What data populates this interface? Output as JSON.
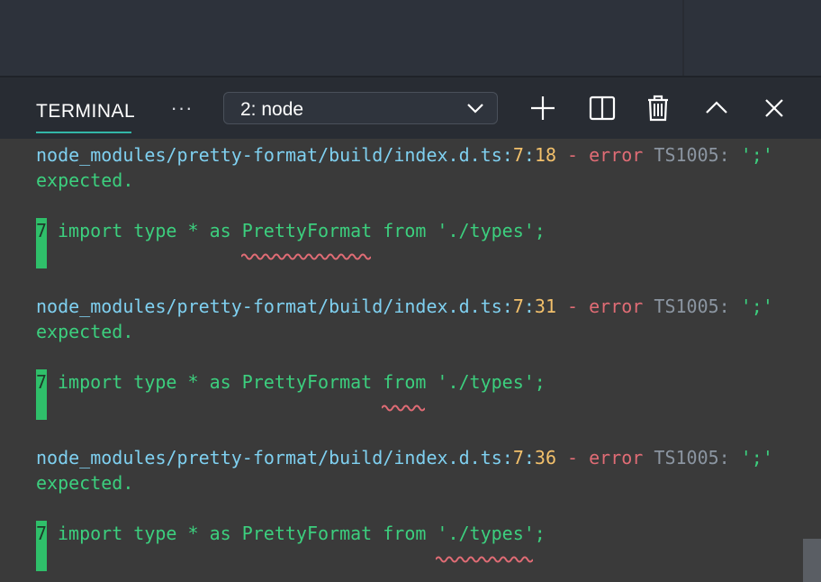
{
  "panel": {
    "tab_label": "TERMINAL",
    "more_label": "···",
    "terminal_select": "2: node"
  },
  "icons": {
    "more": "more-actions-icon",
    "select": "chevron-down-icon",
    "add": "plus-icon",
    "split": "split-terminal-icon",
    "kill": "trash-icon",
    "maximize": "chevron-up-icon",
    "close": "close-icon"
  },
  "colors": {
    "accent": "#33b6a8",
    "error": "#e06c75",
    "path": "#7fd0f0",
    "line_number": "#f2c06b",
    "message": "#3ccf7e"
  },
  "errors": [
    {
      "file": "node_modules/pretty-format/build/index.d.ts",
      "line": "7",
      "col": "18",
      "dash": "-",
      "level": "error",
      "code": "TS1005:",
      "message_part1": "';'",
      "message_part2": "expected.",
      "source_line_number": "7",
      "source": "import type * as PrettyFormat from './types';",
      "squiggle_text": "~~~~~~~~~~~~"
    },
    {
      "file": "node_modules/pretty-format/build/index.d.ts",
      "line": "7",
      "col": "31",
      "dash": "-",
      "level": "error",
      "code": "TS1005:",
      "message_part1": "';'",
      "message_part2": "expected.",
      "source_line_number": "7",
      "source": "import type * as PrettyFormat from './types';",
      "squiggle_text": "~~~~"
    },
    {
      "file": "node_modules/pretty-format/build/index.d.ts",
      "line": "7",
      "col": "36",
      "dash": "-",
      "level": "error",
      "code": "TS1005:",
      "message_part1": "';'",
      "message_part2": "expected.",
      "source_line_number": "7",
      "source": "import type * as PrettyFormat from './types';",
      "squiggle_text": "~~~~~~~~~"
    }
  ]
}
